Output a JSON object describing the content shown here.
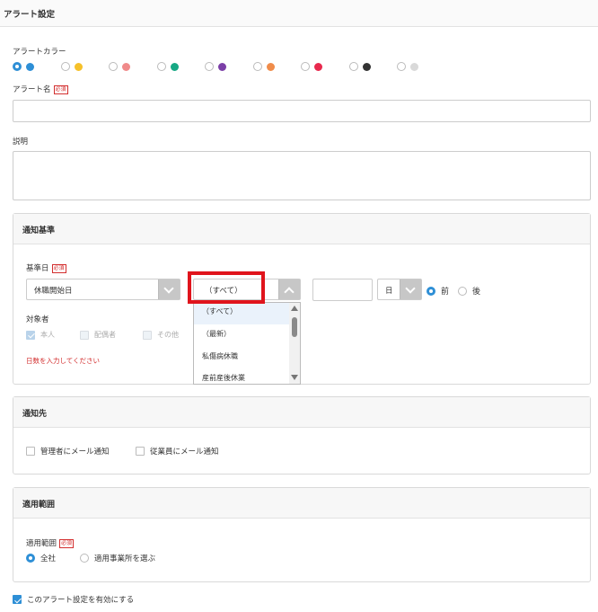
{
  "page": {
    "title": "アラート設定"
  },
  "alert_color": {
    "label": "アラートカラー",
    "options": [
      {
        "name": "blue",
        "color": "#2e8fd6",
        "selected": true
      },
      {
        "name": "yellow",
        "color": "#f6c12a",
        "selected": false
      },
      {
        "name": "pink",
        "color": "#f08a8a",
        "selected": false
      },
      {
        "name": "teal",
        "color": "#17a884",
        "selected": false
      },
      {
        "name": "purple",
        "color": "#7b3fa7",
        "selected": false
      },
      {
        "name": "orange",
        "color": "#f08c4a",
        "selected": false
      },
      {
        "name": "red",
        "color": "#e8294d",
        "selected": false
      },
      {
        "name": "black",
        "color": "#333333",
        "selected": false
      },
      {
        "name": "light-gray",
        "color": "#d9d9d9",
        "selected": false
      }
    ]
  },
  "alert_name": {
    "label": "アラート名",
    "required": "必須",
    "value": ""
  },
  "description": {
    "label": "説明",
    "value": ""
  },
  "notification_basis": {
    "title": "通知基準",
    "base_date": {
      "label": "基準日",
      "required": "必須",
      "type_value": "休職開始日",
      "category_value": "（すべて）",
      "days_value": "",
      "unit_value": "日",
      "before_label": "前",
      "after_label": "後",
      "before_selected": true
    },
    "category_dropdown": {
      "options": [
        "（すべて）",
        "（最新）",
        "私傷病休職",
        "産前産後休業"
      ],
      "selected_index": 0
    },
    "target": {
      "label": "対象者",
      "options": [
        {
          "label": "本人",
          "checked": true
        },
        {
          "label": "配偶者",
          "checked": false
        },
        {
          "label": "その他",
          "checked": false
        }
      ]
    },
    "error_message": "日数を入力してください"
  },
  "notification_target": {
    "title": "通知先",
    "options": [
      {
        "label": "管理者にメール通知",
        "checked": false
      },
      {
        "label": "従業員にメール通知",
        "checked": false
      }
    ]
  },
  "scope": {
    "title": "適用範囲",
    "label": "適用範囲",
    "required": "必須",
    "options": [
      {
        "label": "全社",
        "selected": true
      },
      {
        "label": "適用事業所を選ぶ",
        "selected": false
      }
    ]
  },
  "enable": {
    "label": "このアラート設定を有効にする",
    "checked": true
  }
}
